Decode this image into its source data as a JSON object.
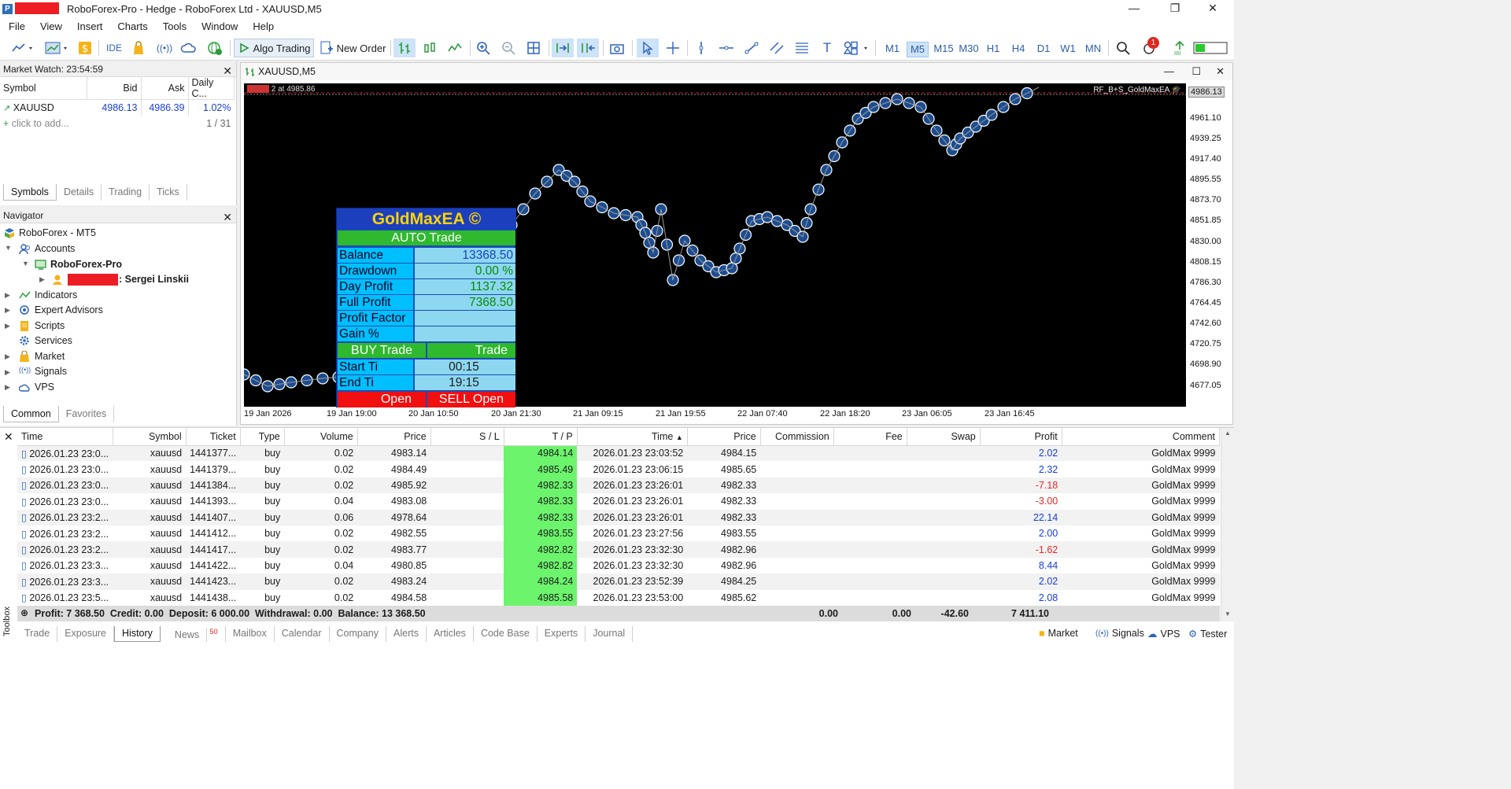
{
  "window": {
    "title": "RoboForex-Pro - Hedge - RoboForex Ltd - XAUUSD,M5"
  },
  "menu": [
    "File",
    "View",
    "Insert",
    "Charts",
    "Tools",
    "Window",
    "Help"
  ],
  "toolbar": {
    "algo_trading": "Algo Trading",
    "new_order": "New Order",
    "timeframes": [
      "M1",
      "M5",
      "M15",
      "M30",
      "H1",
      "H4",
      "D1",
      "W1",
      "MN"
    ],
    "active_timeframe": "M5",
    "notification_count": "1"
  },
  "market_watch": {
    "title": "Market Watch: 23:54:59",
    "columns": [
      "Symbol",
      "Bid",
      "Ask",
      "Daily C..."
    ],
    "rows": [
      {
        "symbol": "XAUUSD",
        "bid": "4986.13",
        "ask": "4986.39",
        "change": "1.02%"
      }
    ],
    "add_hint": "click to add...",
    "count": "1 / 31",
    "tabs": [
      "Symbols",
      "Details",
      "Trading",
      "Ticks"
    ]
  },
  "navigator": {
    "title": "Navigator",
    "root": "RoboForex - MT5",
    "accounts": "Accounts",
    "server": "RoboForex-Pro",
    "user": ": Sergei Linskii",
    "items": [
      "Indicators",
      "Expert Advisors",
      "Scripts",
      "Services",
      "Market",
      "Signals",
      "VPS"
    ],
    "tabs": [
      "Common",
      "Favorites"
    ]
  },
  "chart": {
    "title": "XAUUSD,M5",
    "order_label": "2 at 4985.86",
    "ea_label": "RF_B+S_GoldMaxEA",
    "current_price": "4986.13",
    "price_labels": [
      "4961.10",
      "4939.25",
      "4917.40",
      "4895.55",
      "4873.70",
      "4851.85",
      "4830.00",
      "4808.15",
      "4786.30",
      "4764.45",
      "4742.60",
      "4720.75",
      "4698.90",
      "4677.05"
    ],
    "date_labels": [
      "19 Jan 2026",
      "19 Jan 19:00",
      "20 Jan 10:50",
      "20 Jan 21:30",
      "21 Jan 09:15",
      "21 Jan 19:55",
      "22 Jan 07:40",
      "22 Jan 18:20",
      "23 Jan 06:05",
      "23 Jan 16:45"
    ]
  },
  "goldmax": {
    "title": "GoldMaxEA ©",
    "mode": "AUTO Trade",
    "rows": [
      {
        "label": "Balance",
        "value": "13368.50"
      },
      {
        "label": "Drawdown",
        "value": "0.00 %"
      },
      {
        "label": "Day Profit",
        "value": "1137.32"
      },
      {
        "label": "Full Profit",
        "value": "7368.50"
      },
      {
        "label": "Profit Factor",
        "value": ""
      },
      {
        "label": "Gain %",
        "value": ""
      }
    ],
    "buy_trade": "BUY Trade",
    "sell_trade": "Trade",
    "start_label": "Start Ti",
    "start_value": "00:15",
    "end_label": "End Ti",
    "end_value": "19:15",
    "buy_open": "Open",
    "sell_open": "SELL Open"
  },
  "history": {
    "columns": [
      "Time",
      "Symbol",
      "Ticket",
      "Type",
      "Volume",
      "Price",
      "S / L",
      "T / P",
      "Time",
      "Price",
      "Commission",
      "Fee",
      "Swap",
      "Profit",
      "Comment"
    ],
    "rows": [
      {
        "time": "2026.01.23 23:0...",
        "symbol": "xauusd",
        "ticket": "1441377...",
        "type": "buy",
        "volume": "0.02",
        "price": "4983.14",
        "sl": "",
        "tp": "4984.14",
        "close_time": "2026.01.23 23:03:52",
        "close_price": "4984.15",
        "profit": "2.02",
        "comment": "GoldMax 9999"
      },
      {
        "time": "2026.01.23 23:0...",
        "symbol": "xauusd",
        "ticket": "1441379...",
        "type": "buy",
        "volume": "0.02",
        "price": "4984.49",
        "sl": "",
        "tp": "4985.49",
        "close_time": "2026.01.23 23:06:15",
        "close_price": "4985.65",
        "profit": "2.32",
        "comment": "GoldMax 9999"
      },
      {
        "time": "2026.01.23 23:0...",
        "symbol": "xauusd",
        "ticket": "1441384...",
        "type": "buy",
        "volume": "0.02",
        "price": "4985.92",
        "sl": "",
        "tp": "4982.33",
        "close_time": "2026.01.23 23:26:01",
        "close_price": "4982.33",
        "profit": "-7.18",
        "comment": "GoldMax 9999"
      },
      {
        "time": "2026.01.23 23:0...",
        "symbol": "xauusd",
        "ticket": "1441393...",
        "type": "buy",
        "volume": "0.04",
        "price": "4983.08",
        "sl": "",
        "tp": "4982.33",
        "close_time": "2026.01.23 23:26:01",
        "close_price": "4982.33",
        "profit": "-3.00",
        "comment": "GoldMax 9999"
      },
      {
        "time": "2026.01.23 23:2...",
        "symbol": "xauusd",
        "ticket": "1441407...",
        "type": "buy",
        "volume": "0.06",
        "price": "4978.64",
        "sl": "",
        "tp": "4982.33",
        "close_time": "2026.01.23 23:26:01",
        "close_price": "4982.33",
        "profit": "22.14",
        "comment": "GoldMax 9999"
      },
      {
        "time": "2026.01.23 23:2...",
        "symbol": "xauusd",
        "ticket": "1441412...",
        "type": "buy",
        "volume": "0.02",
        "price": "4982.55",
        "sl": "",
        "tp": "4983.55",
        "close_time": "2026.01.23 23:27:56",
        "close_price": "4983.55",
        "profit": "2.00",
        "comment": "GoldMax 9999"
      },
      {
        "time": "2026.01.23 23:2...",
        "symbol": "xauusd",
        "ticket": "1441417...",
        "type": "buy",
        "volume": "0.02",
        "price": "4983.77",
        "sl": "",
        "tp": "4982.82",
        "close_time": "2026.01.23 23:32:30",
        "close_price": "4982.96",
        "profit": "-1.62",
        "comment": "GoldMax 9999"
      },
      {
        "time": "2026.01.23 23:3...",
        "symbol": "xauusd",
        "ticket": "1441422...",
        "type": "buy",
        "volume": "0.04",
        "price": "4980.85",
        "sl": "",
        "tp": "4982.82",
        "close_time": "2026.01.23 23:32:30",
        "close_price": "4982.96",
        "profit": "8.44",
        "comment": "GoldMax 9999"
      },
      {
        "time": "2026.01.23 23:3...",
        "symbol": "xauusd",
        "ticket": "1441423...",
        "type": "buy",
        "volume": "0.02",
        "price": "4983.24",
        "sl": "",
        "tp": "4984.24",
        "close_time": "2026.01.23 23:52:39",
        "close_price": "4984.25",
        "profit": "2.02",
        "comment": "GoldMax 9999"
      },
      {
        "time": "2026.01.23 23:5...",
        "symbol": "xauusd",
        "ticket": "1441438...",
        "type": "buy",
        "volume": "0.02",
        "price": "4984.58",
        "sl": "",
        "tp": "4985.58",
        "close_time": "2026.01.23 23:53:00",
        "close_price": "4985.62",
        "profit": "2.08",
        "comment": "GoldMax 9999"
      }
    ],
    "totals": {
      "summary": "Profit: 7 368.50  Credit: 0.00  Deposit: 6 000.00  Withdrawal: 0.00  Balance: 13 368.50",
      "commission": "0.00",
      "fee": "0.00",
      "swap": "-42.60",
      "profit": "7 411.10"
    }
  },
  "bottom_tabs": [
    "Trade",
    "Exposure",
    "History",
    "News",
    "Mailbox",
    "Calendar",
    "Company",
    "Alerts",
    "Articles",
    "Code Base",
    "Experts",
    "Journal"
  ],
  "news_count": "50",
  "toolbox_label": "Toolbox",
  "status_items": [
    "Market",
    "Signals",
    "VPS",
    "Tester"
  ]
}
